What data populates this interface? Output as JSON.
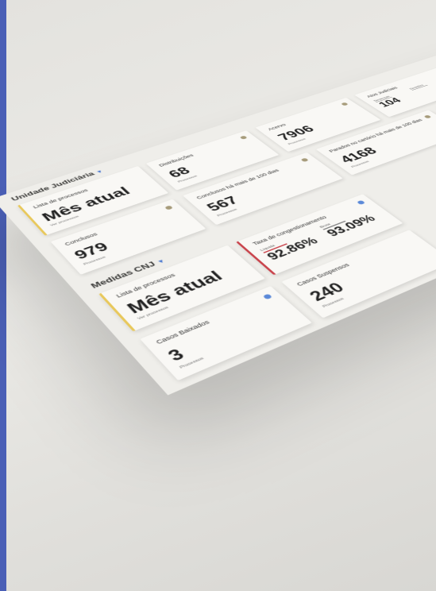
{
  "colors": {
    "edge_bar": "#4a5fb6",
    "accent_yellow": "#e8c85a",
    "accent_red": "#c9434b",
    "info_dot_blue": "#5b89d8",
    "info_dot_tan": "#a69b7a"
  },
  "section_unidade": {
    "title": "Unidade Judiciária"
  },
  "section_metas": {
    "title": "Medidas CNJ"
  },
  "cards": {
    "lista_unidade": {
      "title": "Lista de processos",
      "value": "Mês atual",
      "sub": "Ver processos"
    },
    "distribuicoes": {
      "title": "Distribuições",
      "value": "68",
      "sub": "Processos"
    },
    "acervo": {
      "title": "Acervo",
      "value": "7906",
      "sub": "Processos"
    },
    "atos": {
      "title": "Atos Judiciais",
      "sentencas_label": "Sentenças",
      "sentencas_value": "104",
      "decisoes_label": "Decisões"
    },
    "conclusos": {
      "title": "Conclusos",
      "value": "979",
      "sub": "Processos"
    },
    "conclusos_100": {
      "title": "Conclusos há mais de 100 dias",
      "value": "567",
      "sub": "Processos"
    },
    "parados": {
      "title": "Parados no cartório há mais de 100 dias",
      "value": "4168",
      "sub": "Processos"
    },
    "lista_metas": {
      "title": "Lista de processos",
      "value": "Mês atual",
      "sub": "Ver processos"
    },
    "congestionamento": {
      "title": "Taxa de congestionamento",
      "liquida_label": "Líquida",
      "liquida_value": "92.86%",
      "bruta_label": "Bruta",
      "bruta_value": "93.09%"
    },
    "baixados": {
      "title": "Casos Baixados",
      "value": "3",
      "sub": "Processos"
    },
    "suspensos": {
      "title": "Casos Suspensos",
      "value": "240",
      "sub": "Processos"
    },
    "partial_card": {
      "title": "Ca"
    }
  }
}
